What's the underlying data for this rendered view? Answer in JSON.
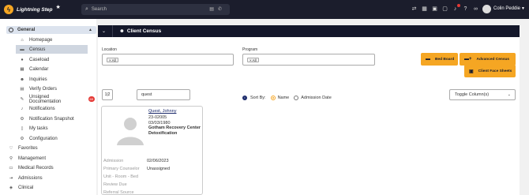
{
  "app": {
    "name": "Lightning Step"
  },
  "search": {
    "placeholder": "Search"
  },
  "user": {
    "name": "Colin Peddie"
  },
  "colors": {
    "accent": "#f5a623",
    "topbar": "#1b1d2c",
    "badge": "#e53935"
  },
  "sidebar": {
    "general_label": "General",
    "items": [
      {
        "label": "Homepage",
        "icon": "home-icon"
      },
      {
        "label": "Census",
        "icon": "census-icon"
      },
      {
        "label": "Caseload",
        "icon": "person-icon"
      },
      {
        "label": "Calendar",
        "icon": "calendar-icon"
      },
      {
        "label": "Inquiries",
        "icon": "people-icon"
      },
      {
        "label": "Verify Orders",
        "icon": "document-icon"
      },
      {
        "label": "Unsigned Documentation",
        "icon": "pen-icon",
        "badge": "69"
      },
      {
        "label": "Notifications",
        "icon": "bell-icon"
      },
      {
        "label": "Notification Snapshot",
        "icon": "gear-icon"
      },
      {
        "label": "My tasks",
        "icon": "clipboard-icon"
      },
      {
        "label": "Configuration",
        "icon": "gear-icon"
      }
    ],
    "sections": [
      {
        "label": "Favorites",
        "icon": "heart-icon"
      },
      {
        "label": "Management",
        "icon": "pin-icon"
      },
      {
        "label": "Medical Records",
        "icon": "folder-icon"
      },
      {
        "label": "Admissions",
        "icon": "admissions-icon"
      },
      {
        "label": "Clinical",
        "icon": "tag-icon"
      }
    ]
  },
  "panel": {
    "title": "Client Census"
  },
  "filters": {
    "location_label": "Location",
    "location_chip": "× All",
    "program_label": "Program",
    "program_chip": "× All"
  },
  "buttons": {
    "bed_board": "Bed Board",
    "advanced_census": "Advanced Census",
    "client_face_sheets": "Client Face Sheets"
  },
  "controls": {
    "sort_toggle": "1|2",
    "search_value": "quest",
    "sort_by_label": "Sort By:",
    "sort_name": "Name",
    "sort_admission": "Admission Date",
    "toggle_columns": "Toggle Column(s)"
  },
  "client_card": {
    "name": "Quest, Johnny",
    "id": "23-02005",
    "dob": "03/03/1980",
    "facility": "Gotham Recovery Center Detoxification",
    "details": [
      {
        "label": "Admission",
        "value": "02/06/2023"
      },
      {
        "label": "Primary Counselor",
        "value": "Unassigned"
      },
      {
        "label": "Unit - Room - Bed",
        "value": ""
      },
      {
        "label": "Review Due",
        "value": ""
      },
      {
        "label": "Referral Source",
        "value": ""
      }
    ]
  }
}
